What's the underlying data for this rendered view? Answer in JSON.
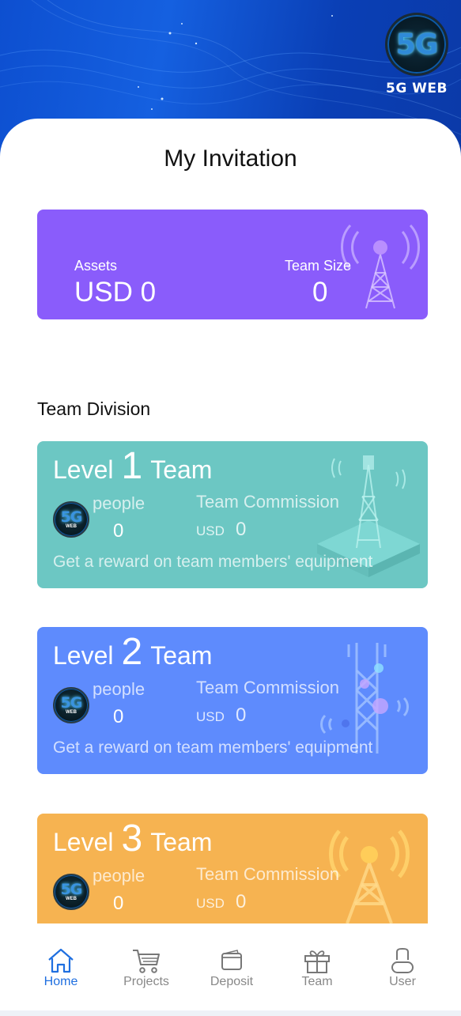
{
  "brand": {
    "badge_text": "5G",
    "name": "5G WEB"
  },
  "page_title": "My Invitation",
  "summary": {
    "assets_label": "Assets",
    "assets_value": "USD 0",
    "team_size_label": "Team Size",
    "team_size_value": "0",
    "color": "#8a5cfb"
  },
  "team_division": {
    "title": "Team Division",
    "levels": [
      {
        "level_word": "Level",
        "level_number": "1",
        "team_word": "Team",
        "badge_text": "5G",
        "badge_sub": "WEB",
        "people_label": "people",
        "people_value": "0",
        "commission_label": "Team Commission",
        "commission_currency": "USD",
        "commission_value": "0",
        "reward_text": "Get a reward on team members' equipment",
        "color": "#6cc7c3"
      },
      {
        "level_word": "Level",
        "level_number": "2",
        "team_word": "Team",
        "badge_text": "5G",
        "badge_sub": "WEB",
        "people_label": "people",
        "people_value": "0",
        "commission_label": "Team Commission",
        "commission_currency": "USD",
        "commission_value": "0",
        "reward_text": "Get a reward on team members' equipment",
        "color": "#5e8bfd"
      },
      {
        "level_word": "Level",
        "level_number": "3",
        "team_word": "Team",
        "badge_text": "5G",
        "badge_sub": "WEB",
        "people_label": "people",
        "people_value": "0",
        "commission_label": "Team Commission",
        "commission_currency": "USD",
        "commission_value": "0",
        "color": "#f6b351"
      }
    ]
  },
  "tabbar": {
    "items": [
      {
        "label": "Home",
        "icon": "home-icon",
        "active": true
      },
      {
        "label": "Projects",
        "icon": "cart-icon",
        "active": false
      },
      {
        "label": "Deposit",
        "icon": "wallet-icon",
        "active": false
      },
      {
        "label": "Team",
        "icon": "gift-icon",
        "active": false
      },
      {
        "label": "User",
        "icon": "user-icon",
        "active": false
      }
    ],
    "active_color": "#1f6fe0",
    "inactive_color": "#888888"
  }
}
